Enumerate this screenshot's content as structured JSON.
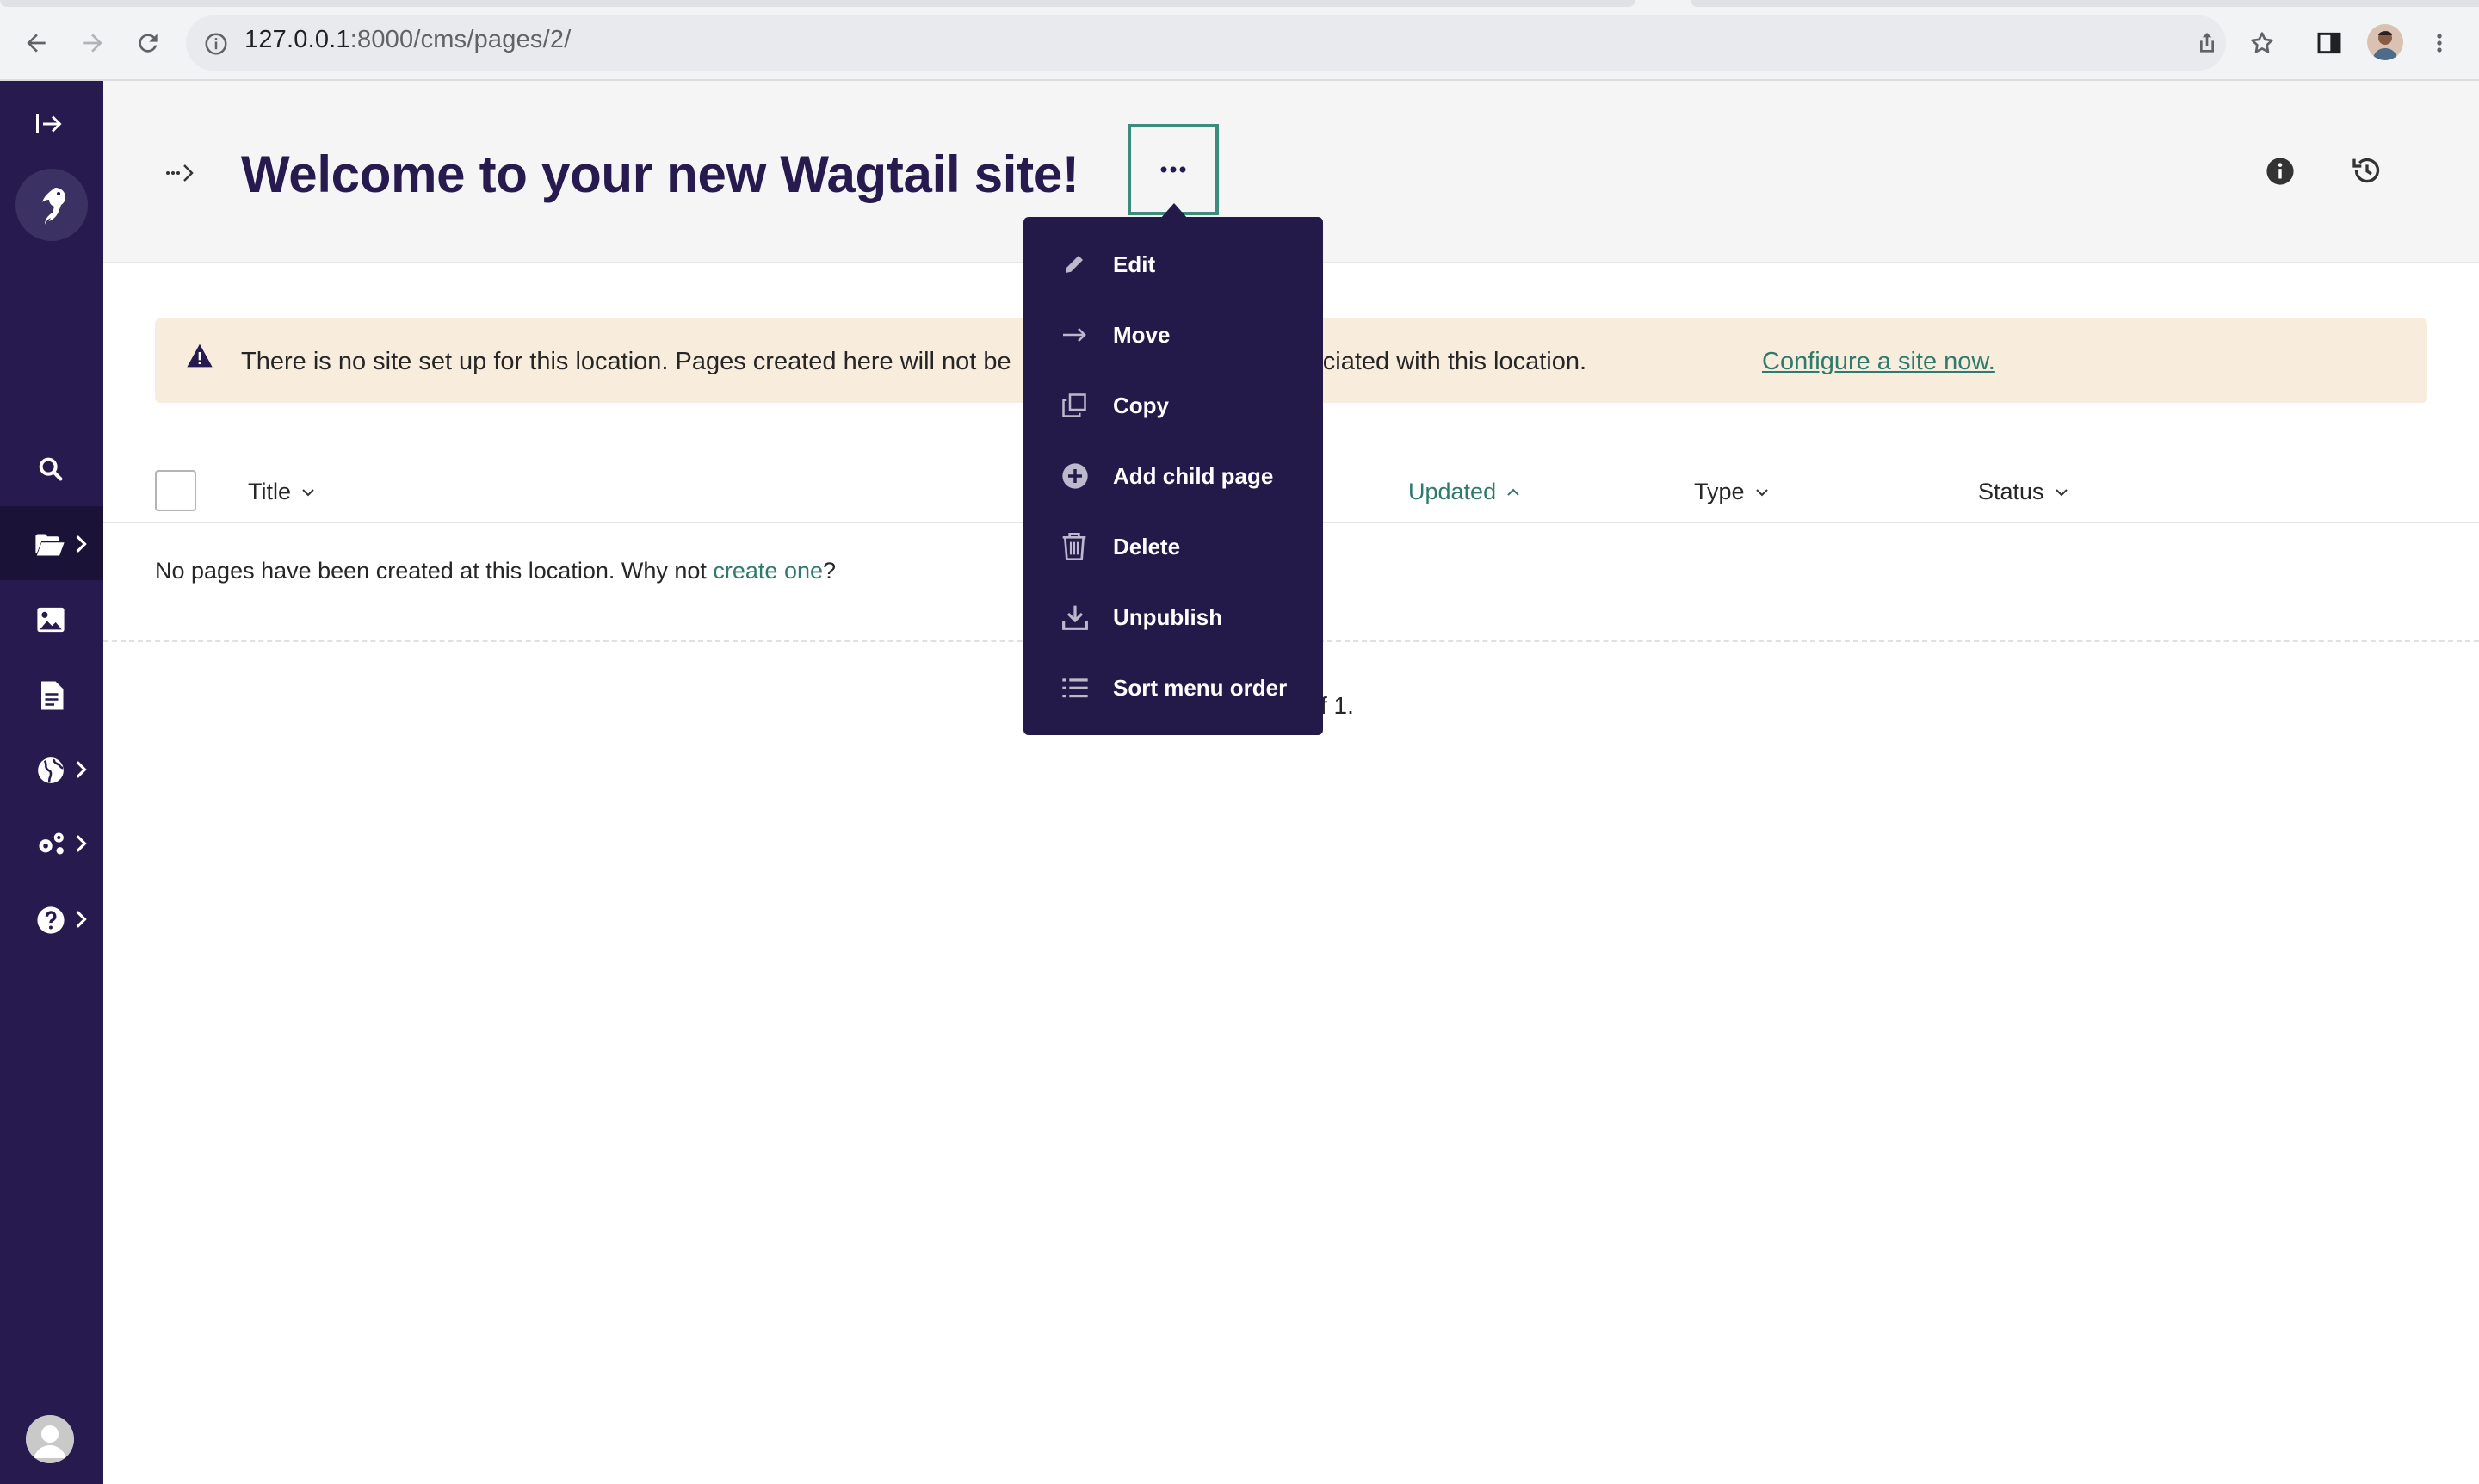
{
  "browser": {
    "url_host": "127.0.0.1",
    "url_path": ":8000/cms/pages/2/"
  },
  "sidebar": {
    "items": [
      {
        "name": "toggle-sidebar",
        "icon": "expand-icon"
      },
      {
        "name": "search",
        "icon": "search-icon"
      },
      {
        "name": "pages",
        "icon": "folder-open-icon",
        "has_submenu": true
      },
      {
        "name": "images",
        "icon": "image-icon"
      },
      {
        "name": "documents",
        "icon": "document-icon"
      },
      {
        "name": "sites",
        "icon": "globe-icon",
        "has_submenu": true
      },
      {
        "name": "settings",
        "icon": "cogs-icon",
        "has_submenu": true
      },
      {
        "name": "help",
        "icon": "help-icon",
        "has_submenu": true
      }
    ]
  },
  "header": {
    "title": "Welcome to your new Wagtail site!",
    "more_label": "···"
  },
  "banner": {
    "text_before": "There is no site set up for this location. Pages created here will not be",
    "text_after": "l a site is associated with this location.",
    "link": "Configure a site now."
  },
  "table": {
    "columns": [
      {
        "label": "Title",
        "sort": "down"
      },
      {
        "label": "Updated",
        "sort": "up",
        "active": true
      },
      {
        "label": "Type",
        "sort": "down"
      },
      {
        "label": "Status",
        "sort": "down"
      }
    ],
    "empty_prefix": "No pages have been created at this location. Why not ",
    "empty_link": "create one",
    "empty_suffix": "?",
    "pagination": "f 1."
  },
  "dropdown": {
    "items": [
      {
        "label": "Edit",
        "icon": "edit-icon"
      },
      {
        "label": "Move",
        "icon": "arrow-right-icon"
      },
      {
        "label": "Copy",
        "icon": "copy-icon"
      },
      {
        "label": "Add child page",
        "icon": "plus-circle-icon"
      },
      {
        "label": "Delete",
        "icon": "bin-icon"
      },
      {
        "label": "Unpublish",
        "icon": "download-icon"
      },
      {
        "label": "Sort menu order",
        "icon": "list-icon"
      }
    ]
  },
  "colors": {
    "sidebar": "#261a4f",
    "accent": "#2e7a6c",
    "title": "#261a4f",
    "banner": "#f8ecdc",
    "dropdown": "#231a4a"
  }
}
